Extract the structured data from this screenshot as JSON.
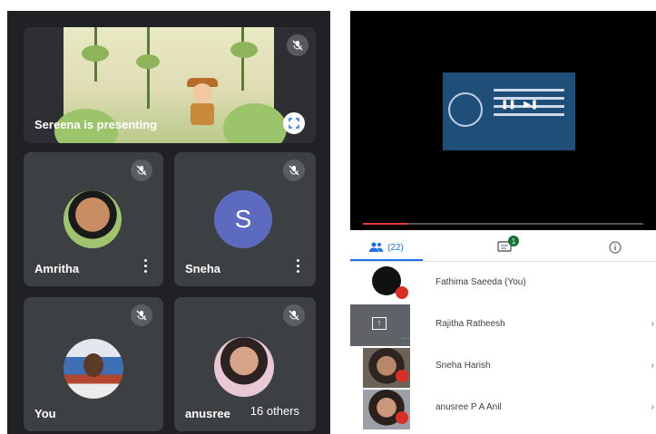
{
  "left": {
    "presenter_label": "Sereena is presenting",
    "tiles": [
      {
        "name": "Amritha"
      },
      {
        "name": "Sneha",
        "initial": "S"
      },
      {
        "name": "You"
      },
      {
        "name": "anusree"
      }
    ],
    "others_label": "16 others"
  },
  "right": {
    "tabs": {
      "people_count": "(22)",
      "chat_badge": "1"
    },
    "participants": [
      {
        "name": "Fathima Saeeda (You)"
      },
      {
        "name": "Rajitha Ratheesh"
      },
      {
        "name": "Sneha Harish"
      },
      {
        "name": "anusree P A Anil"
      }
    ]
  },
  "colors": {
    "accent": "#1a73e8",
    "dark_bg": "#202124",
    "tile_bg": "#3c4043",
    "sneha_avatar": "#5c6bc0"
  },
  "icons": [
    "mic-off-icon",
    "fullscreen-icon",
    "more-vert-icon",
    "people-icon",
    "chat-icon",
    "info-icon",
    "present-to-all-icon",
    "chevron-right-icon"
  ]
}
